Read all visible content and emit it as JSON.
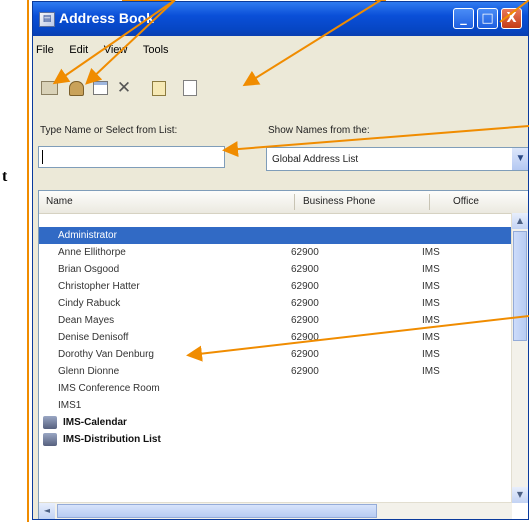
{
  "side_text": "t",
  "window": {
    "title": "Address Book",
    "title_icon": "address-book-icon",
    "buttons": {
      "minimize": "_",
      "maximize": "□",
      "close": "X"
    }
  },
  "menu": [
    "File",
    "Edit",
    "View",
    "Tools"
  ],
  "toolbar": {
    "icons": [
      "address-book-icon",
      "new-entry-icon",
      "properties-icon",
      "delete-icon",
      "find-icon",
      "new-message-icon"
    ],
    "delete_glyph": "✕"
  },
  "search": {
    "label": "Type Name or Select from List:",
    "value": ""
  },
  "show_names": {
    "label": "Show Names from the:",
    "value": "Global Address List",
    "arrow": "▼"
  },
  "list": {
    "columns": [
      "Name",
      "Business Phone",
      "Office"
    ],
    "rows": [
      {
        "name": "Administrator",
        "phone": "",
        "office": "",
        "selected": true
      },
      {
        "name": "Anne Ellithorpe",
        "phone": "62900",
        "office": "IMS"
      },
      {
        "name": "Brian Osgood",
        "phone": "62900",
        "office": "IMS"
      },
      {
        "name": "Christopher Hatter",
        "phone": "62900",
        "office": "IMS"
      },
      {
        "name": "Cindy Rabuck",
        "phone": "62900",
        "office": "IMS"
      },
      {
        "name": "Dean Mayes",
        "phone": "62900",
        "office": "IMS"
      },
      {
        "name": "Denise Denisoff",
        "phone": "62900",
        "office": "IMS"
      },
      {
        "name": "Dorothy Van Denburg",
        "phone": "62900",
        "office": "IMS"
      },
      {
        "name": "Glenn Dionne",
        "phone": "62900",
        "office": "IMS"
      },
      {
        "name": "IMS Conference Room",
        "phone": "",
        "office": ""
      },
      {
        "name": "IMS1",
        "phone": "",
        "office": ""
      },
      {
        "name": "IMS-Calendar",
        "phone": "",
        "office": "",
        "group": true
      },
      {
        "name": "IMS-Distribution List",
        "phone": "",
        "office": "",
        "group": true
      }
    ]
  },
  "scroll": {
    "up": "▲",
    "down": "▼",
    "left": "◄"
  },
  "colors": {
    "titlebar": "#0a4fd8",
    "selection": "#316ac5",
    "annotation_arrow": "#f08c00"
  }
}
